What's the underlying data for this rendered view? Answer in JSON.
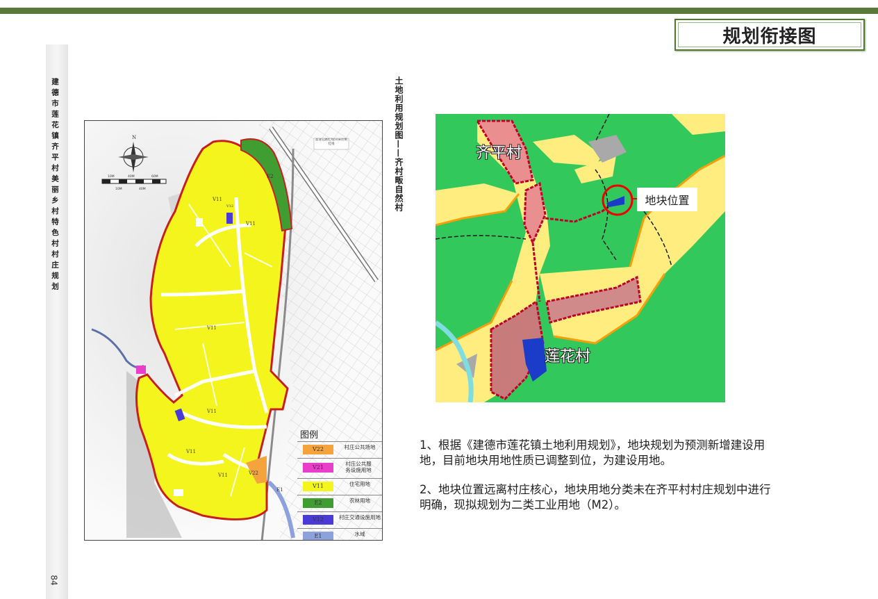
{
  "header": {
    "title": "规划衔接图"
  },
  "sidebar": {
    "vertical_text": "建德市莲花镇齐平村美丽乡村特色村村庄规划",
    "page_number": "84"
  },
  "left_map": {
    "title": "土地利用规划图——齐村畈自然村",
    "north_label": "N",
    "scale_labels": [
      "10M",
      "40M",
      "60M",
      "10M",
      "40M"
    ],
    "note": "高速公路红线50米控制红线",
    "zone_labels": [
      "V11",
      "V11",
      "V11",
      "V11",
      "V11",
      "V11",
      "V12",
      "V22",
      "E2",
      "E1"
    ],
    "legend": {
      "title": "图例",
      "items": [
        {
          "code": "V22",
          "label": "村庄公共场地",
          "color": "#f5a33c"
        },
        {
          "code": "V21",
          "label": "村庄公共服务设施用地",
          "color": "#e93ec9"
        },
        {
          "code": "V11",
          "label": "住宅用地",
          "color": "#f5f51e"
        },
        {
          "code": "E2",
          "label": "农林用地",
          "color": "#3f9d32"
        },
        {
          "code": "V12",
          "label": "村庄交通设施用地",
          "color": "#4b3bd6"
        },
        {
          "code": "E1",
          "label": "水域",
          "color": "#8da2dd"
        }
      ]
    }
  },
  "right_map": {
    "village_labels": [
      "齐平村",
      "莲花村"
    ],
    "callout": "地块位置"
  },
  "notes": [
    "1、根据《建德市莲花镇土地利用规划》，地块规划为预测新增建设用地，目前地块用地性质已调整到位，为建设用地。",
    "2、地块位置远离村庄核心，地块用地分类未在齐平村村庄规划中进行明确，现拟规划为二类工业用地（M2）。"
  ]
}
